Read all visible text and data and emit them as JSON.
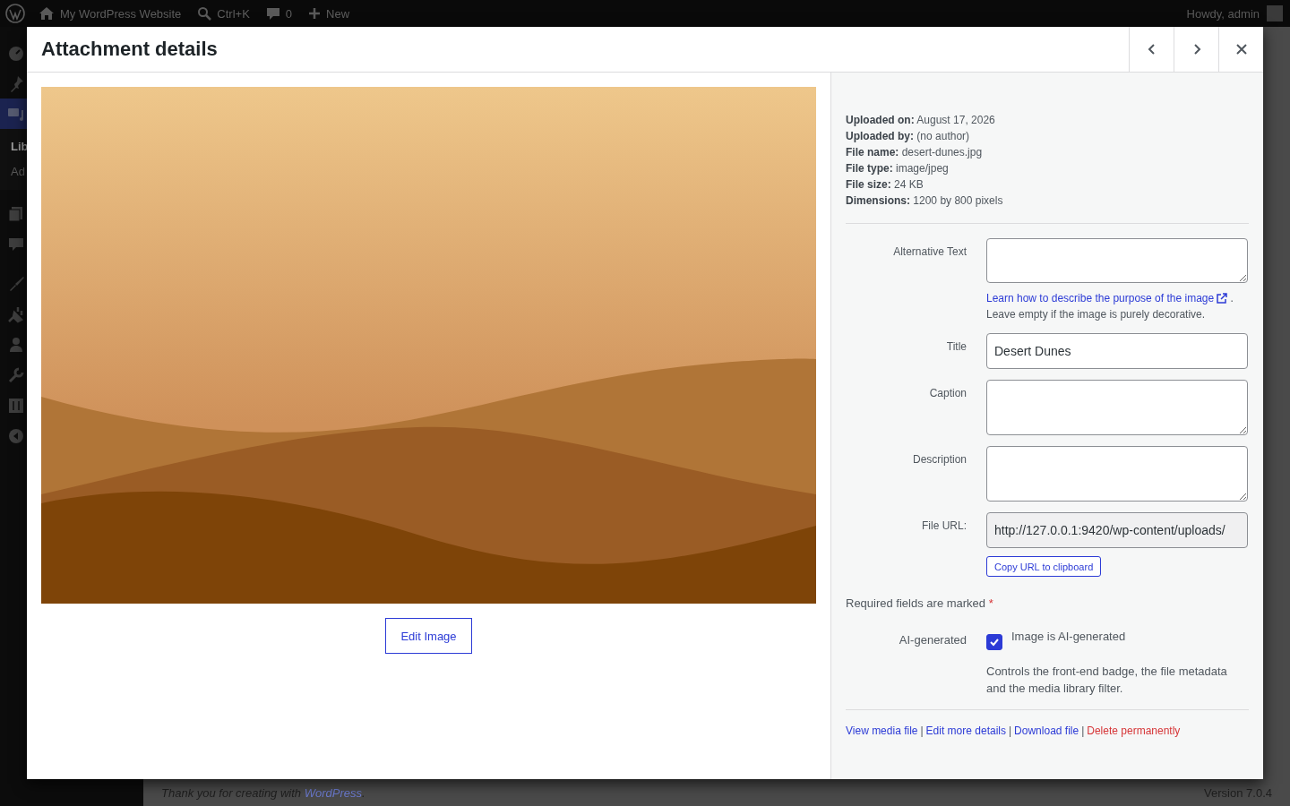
{
  "admin_bar": {
    "items": [
      {
        "kind": "logo"
      },
      {
        "kind": "home",
        "label": "My WordPress Website"
      },
      {
        "kind": "search",
        "label": "Ctrl+K"
      },
      {
        "kind": "comments",
        "label": "0"
      },
      {
        "kind": "new",
        "label": "New"
      }
    ],
    "account": "Howdy, admin"
  },
  "sidebar": {
    "items": [
      {
        "kind": "dashboard",
        "selected": false
      },
      {
        "kind": "posts",
        "selected": false
      },
      {
        "kind": "media",
        "selected": true,
        "children": [
          {
            "label": "Lib",
            "selected": true
          },
          {
            "label": "Ad",
            "selected": false
          }
        ]
      },
      {
        "kind": "pages",
        "selected": false
      },
      {
        "kind": "comments",
        "selected": false
      },
      {
        "kind": "appearance",
        "selected": false
      },
      {
        "kind": "plugins",
        "selected": false
      },
      {
        "kind": "users",
        "selected": false
      },
      {
        "kind": "tools",
        "selected": false
      },
      {
        "kind": "settings",
        "selected": false
      },
      {
        "kind": "collapse",
        "selected": false
      }
    ]
  },
  "footer": {
    "thanks": {
      "before": "Thank you for creating with ",
      "link": "WordPress",
      "after": "."
    },
    "version": "Version 7.0.4"
  },
  "modal": {
    "title": "Attachment details",
    "nav_buttons": [
      {
        "kind": "previous"
      },
      {
        "kind": "next"
      },
      {
        "kind": "close"
      }
    ],
    "edit_button": "Edit Image",
    "details": [
      {
        "label": "Uploaded on:",
        "value": "August 17, 2026"
      },
      {
        "label": "Uploaded by:",
        "value": "(no author)"
      },
      {
        "label": "File name:",
        "value": "desert-dunes.jpg"
      },
      {
        "label": "File type:",
        "value": "image/jpeg"
      },
      {
        "label": "File size:",
        "value": "24 KB"
      },
      {
        "label": "Dimensions:",
        "value": "1200 by 800 pixels"
      }
    ],
    "fields": [
      {
        "kind": "textarea",
        "label": "Alternative Text",
        "help_link": "Learn how to describe the purpose of the image",
        "help_after": ".",
        "help_note": "Leave empty if the image is purely decorative."
      },
      {
        "kind": "text",
        "label": "Title",
        "value": "Desert Dunes"
      },
      {
        "kind": "textarea",
        "label": "Caption"
      },
      {
        "kind": "textarea",
        "label": "Description"
      },
      {
        "kind": "readonly",
        "label": "File URL:",
        "value": "http://127.0.0.1:9420/wp-content/uploads/",
        "button": "Copy URL to clipboard"
      }
    ],
    "required_note": {
      "text": "Required fields are marked",
      "mark": "*"
    },
    "ai": {
      "label": "AI-generated",
      "checkbox_label": "Image is AI-generated",
      "checked": true,
      "description": "Controls the front-end badge, the file metadata and the media library filter."
    },
    "actions": [
      {
        "kind": "link",
        "label": "View media file"
      },
      {
        "kind": "link",
        "label": "Edit more details"
      },
      {
        "kind": "link",
        "label": "Download file"
      },
      {
        "kind": "danger",
        "label": "Delete permanently"
      }
    ],
    "action_separator": "|"
  }
}
